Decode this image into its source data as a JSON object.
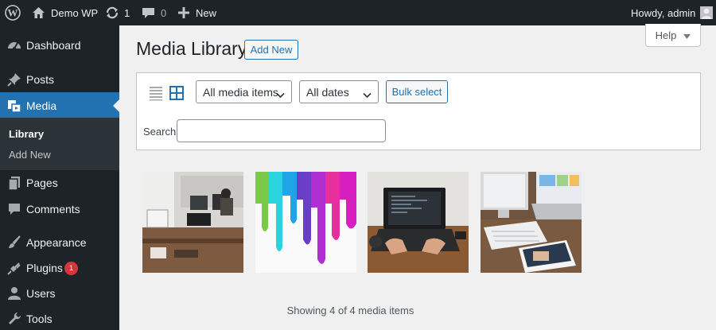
{
  "adminbar": {
    "site_name": "Demo WP",
    "updates_count": "1",
    "comments_count": "0",
    "new_label": "New",
    "howdy": "Howdy, admin"
  },
  "sidebar": {
    "items": [
      {
        "label": "Dashboard",
        "icon": "dashboard-icon"
      },
      {
        "label": "Posts",
        "icon": "pushpin-icon"
      },
      {
        "label": "Media",
        "icon": "media-icon"
      },
      {
        "label": "Pages",
        "icon": "pages-icon"
      },
      {
        "label": "Comments",
        "icon": "comment-icon"
      },
      {
        "label": "Appearance",
        "icon": "paintbrush-icon"
      },
      {
        "label": "Plugins",
        "icon": "plugin-icon"
      },
      {
        "label": "Users",
        "icon": "user-icon"
      },
      {
        "label": "Tools",
        "icon": "wrench-icon"
      }
    ],
    "submenu": [
      "Library",
      "Add New"
    ],
    "plugins_badge": "1"
  },
  "help_label": "Help",
  "page": {
    "title": "Media Library",
    "add_new_label": "Add New"
  },
  "toolbar": {
    "type_filter": "All media items",
    "date_filter": "All dates",
    "bulk_select_label": "Bulk select",
    "search_label": "Search",
    "search_value": ""
  },
  "media_items": [
    {
      "description": "office-desk-photo"
    },
    {
      "description": "paint-drips-photo"
    },
    {
      "description": "laptop-typing-photo"
    },
    {
      "description": "computer-devices-photo"
    }
  ],
  "status": "Showing 4 of 4 media items",
  "colors": {
    "admin_dark": "#1d2327",
    "accent": "#2271b1",
    "badge": "#d63638"
  }
}
